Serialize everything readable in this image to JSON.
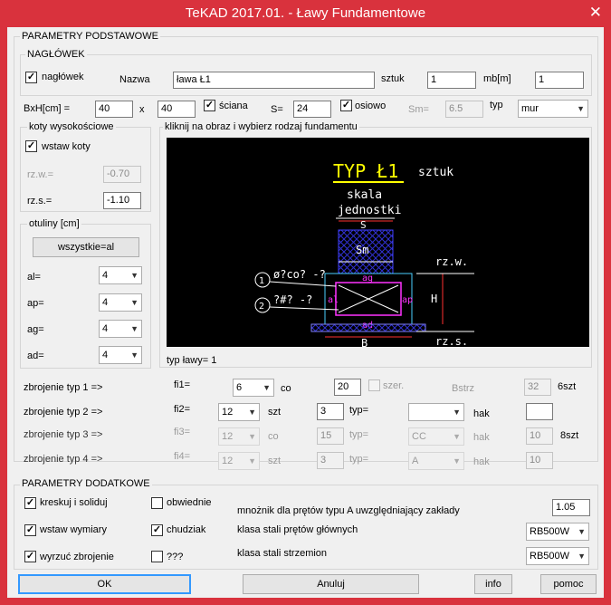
{
  "window": {
    "title": "TeKAD 2017.01. - Ławy Fundamentowe",
    "close_glyph": "✕"
  },
  "basic": {
    "legend": "PARAMETRY PODSTAWOWE"
  },
  "header": {
    "legend": "NAGŁÓWEK",
    "naglowek_label": "nagłówek",
    "naglowek_checked": true,
    "nazwa_label": "Nazwa",
    "nazwa_value": "ława Ł1",
    "sztuk_label": "sztuk",
    "sztuk_value": "1",
    "mb_label": "mb[m]",
    "mb_value": "1"
  },
  "dims": {
    "bxh_label": "BxH[cm] =",
    "b_value": "40",
    "x_label": "x",
    "h_value": "40",
    "sciana_label": "ściana",
    "sciana_checked": true,
    "s_label": "S=",
    "s_value": "24",
    "osiowo_label": "osiowo",
    "osiowo_checked": true,
    "sm_label": "Sm=",
    "sm_value": "6.5",
    "typ_label": "typ",
    "typ_value": "mur"
  },
  "koty": {
    "legend": "koty wysokościowe",
    "wstaw_label": "wstaw koty",
    "wstaw_checked": true,
    "rzw_label": "rz.w.=",
    "rzw_value": "-0.70",
    "rzs_label": "rz.s.=",
    "rzs_value": "-1.10"
  },
  "otuliny": {
    "legend": "otuliny [cm]",
    "button": "wszystkie=al",
    "rows": [
      {
        "label": "al=",
        "value": "4"
      },
      {
        "label": "ap=",
        "value": "4"
      },
      {
        "label": "ag=",
        "value": "4"
      },
      {
        "label": "ad=",
        "value": "4"
      }
    ]
  },
  "drawing": {
    "legend": "kliknij na obraz i wybierz rodzaj fundamentu",
    "typ_caption": "typ ławy= 1",
    "title": "TYP Ł1",
    "sztuk": "sztuk",
    "skala1": "skala",
    "skala2": "jednostki",
    "s": "S",
    "sm": "Sm",
    "ag": "ag",
    "ad": "ad",
    "al": "al",
    "ap": "ap",
    "b": "B",
    "h": "H",
    "rzw": "rz.w.",
    "rzs": "rz.s.",
    "c1": "1",
    "c2": "2",
    "rebar1": "ø?co? -?",
    "rebar2": "?#? -?"
  },
  "rebar": {
    "rows": [
      {
        "label": "zbrojenie typ 1 =>",
        "fi_label": "fi1=",
        "fi_value": "6",
        "mid_label": "co",
        "val": "20",
        "szer_label": "szer.",
        "bstrz_label": "Bstrz",
        "bstrz_value": "32",
        "suffix": "6szt"
      },
      {
        "label": "zbrojenie typ 2 =>",
        "fi_label": "fi2=",
        "fi_value": "12",
        "mid_label": "szt",
        "val": "3",
        "typ_label": "typ=",
        "typ_value": "",
        "hak_label": "hak",
        "hak_value": ""
      },
      {
        "label": "zbrojenie typ 3 =>",
        "fi_label": "fi3=",
        "fi_value": "12",
        "mid_label": "co",
        "val": "15",
        "typ_label": "typ=",
        "typ_value": "CC",
        "hak_label": "hak",
        "hak_value": "10",
        "suffix": "8szt"
      },
      {
        "label": "zbrojenie typ 4 =>",
        "fi_label": "fi4=",
        "fi_value": "12",
        "mid_label": "szt",
        "val": "3",
        "typ_label": "typ=",
        "typ_value": "A",
        "hak_label": "hak",
        "hak_value": "10"
      }
    ]
  },
  "extra": {
    "legend": "PARAMETRY DODATKOWE",
    "kreskuj": "kreskuj i soliduj",
    "wstaw_wymiary": "wstaw wymiary",
    "wyrzuc": "wyrzuć zbrojenie",
    "obwiednie": "obwiednie",
    "chudziak": "chudziak",
    "qqq": "???",
    "mnoznik_label": "mnożnik dla prętów typu A uwzględniający zakłady",
    "mnoznik_value": "1.05",
    "klasa_gl_label": "klasa stali prętów głównych",
    "klasa_gl_value": "RB500W",
    "klasa_strz_label": "klasa stali strzemion",
    "klasa_strz_value": "RB500W"
  },
  "buttons": {
    "ok": "OK",
    "anuluj": "Anuluj",
    "info": "info",
    "pomoc": "pomoc"
  },
  "colors": {
    "titlebar": "#d9323d",
    "drawing_bg": "#000000",
    "accent": "#ffff00"
  }
}
